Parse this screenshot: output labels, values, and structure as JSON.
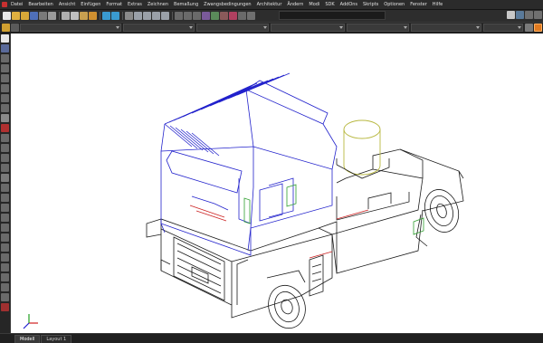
{
  "menubar": {
    "items": [
      "Datei",
      "Bearbeiten",
      "Ansicht",
      "Einfügen",
      "Format",
      "Extras",
      "Zeichnen",
      "Bemaßung",
      "Zwangsbedingungen",
      "Architektur",
      "Ändern",
      "Modi",
      "SDK",
      "AddOns",
      "Skripts",
      "Optionen",
      "Fenster",
      "Hilfe"
    ]
  },
  "tabs": {
    "model": "Modell",
    "layout": "Layout 1"
  },
  "colors": {
    "outline": "#1a1a1a",
    "cab_blue": "#2222cc",
    "accent_green": "#2e9e2e",
    "accent_red": "#cc2222",
    "yellow_cylinder": "#b8b840",
    "ucs_red": "#d02020",
    "ucs_green": "#20a020",
    "ucs_blue": "#2020d0"
  }
}
